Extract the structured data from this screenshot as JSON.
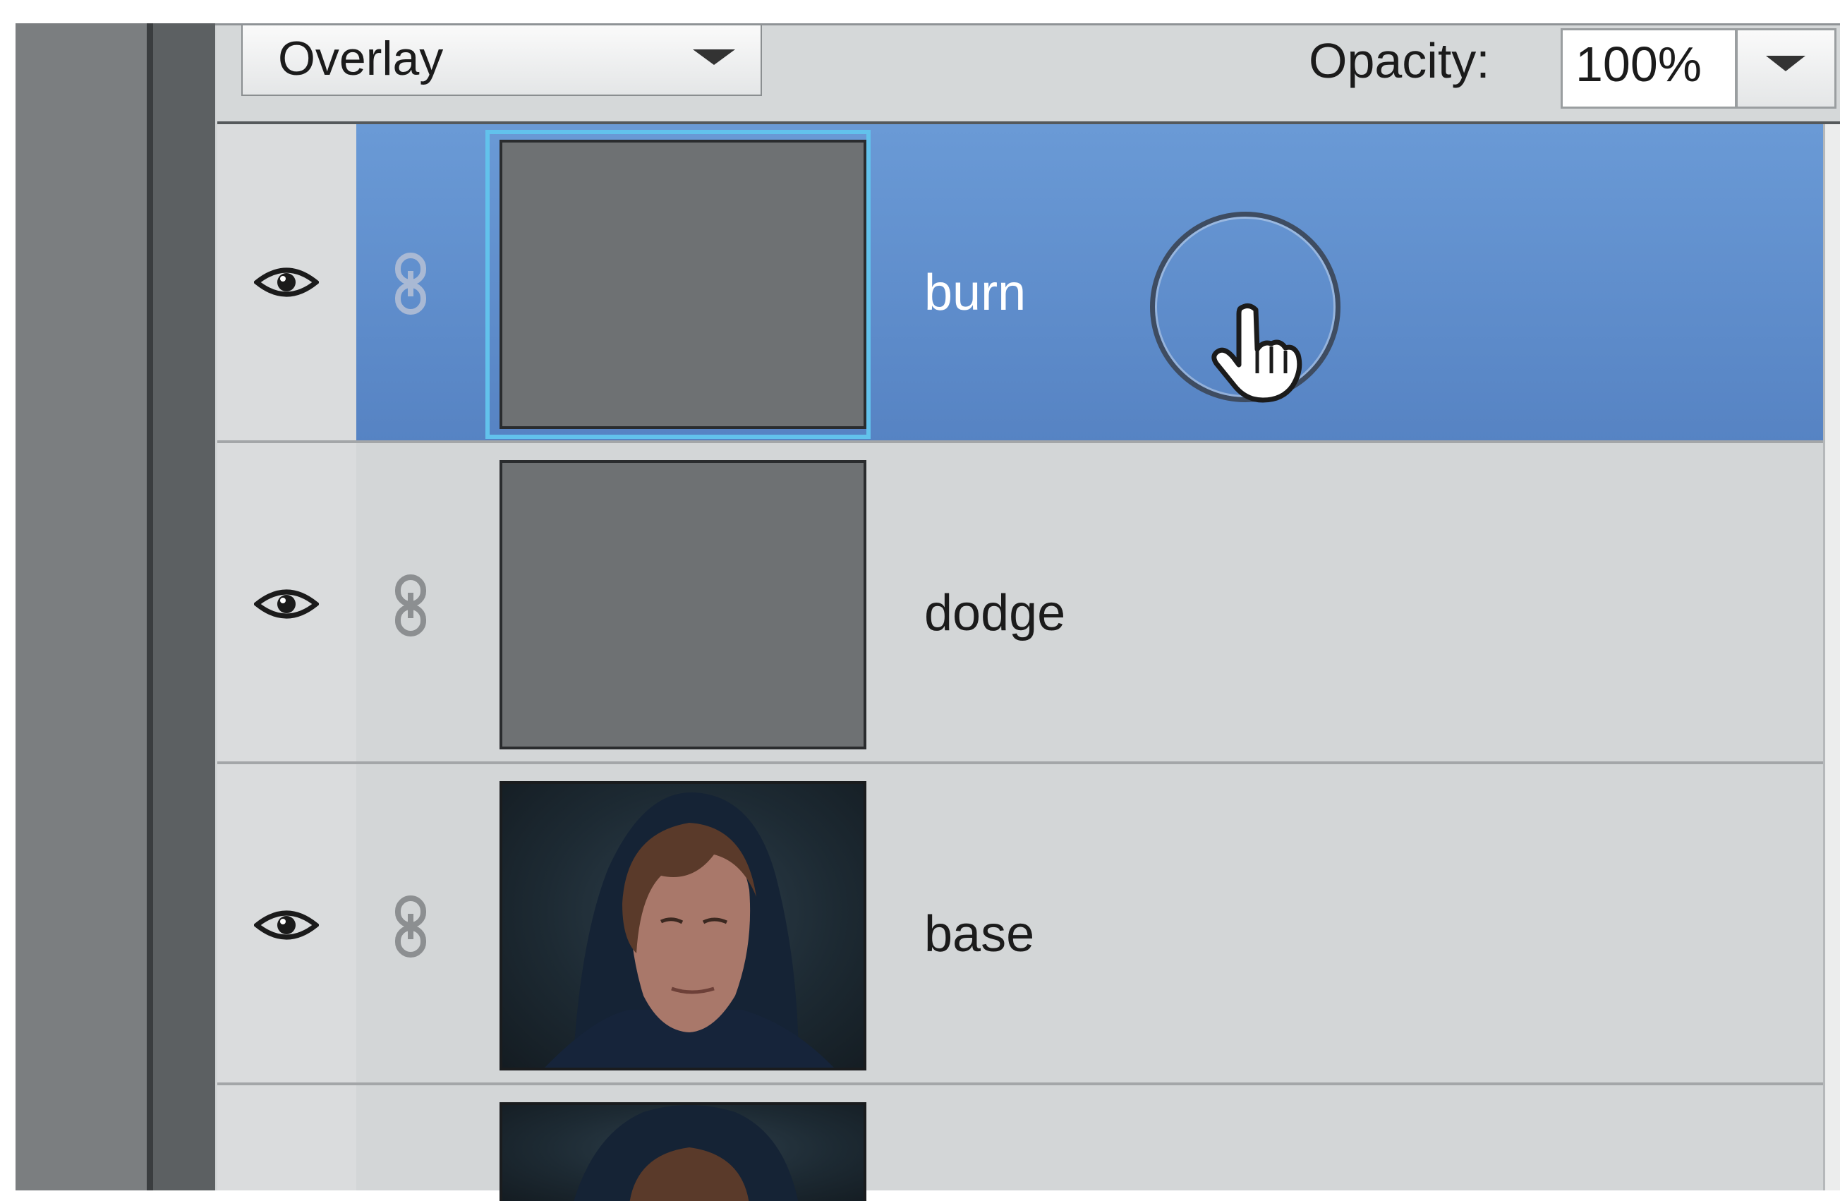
{
  "toolbar": {
    "blend_mode": "Overlay",
    "opacity_label": "Opacity:",
    "opacity_value": "100%"
  },
  "layers": [
    {
      "name": "burn",
      "selected": true,
      "visible": true,
      "thumbnail": "gray-fill"
    },
    {
      "name": "dodge",
      "selected": false,
      "visible": true,
      "thumbnail": "gray-fill"
    },
    {
      "name": "base",
      "selected": false,
      "visible": true,
      "thumbnail": "portrait-photo"
    },
    {
      "name": "",
      "selected": false,
      "visible": false,
      "thumbnail": "portrait-photo"
    }
  ],
  "icons": {
    "visibility": "eye-icon",
    "link": "link-icon",
    "cursor": "hand-pointer-icon",
    "dropdown": "chevron-down-icon"
  },
  "colors": {
    "selection": "#5f8fd0",
    "thumbnail_highlight": "#62c2ec",
    "panel_bg": "#d3d6d7"
  }
}
